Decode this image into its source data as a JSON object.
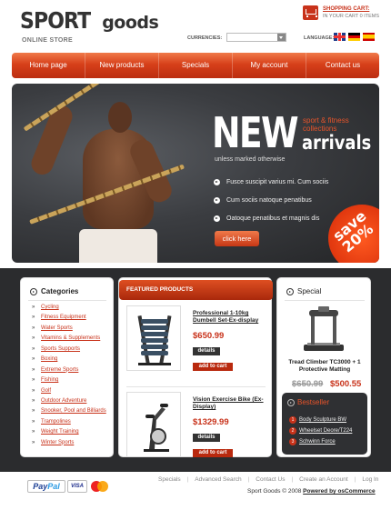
{
  "header": {
    "logo_main": "SPORT",
    "logo_secondary": "goods",
    "logo_subtitle": "ONLINE STORE",
    "cart_title": "SHOPPING CART:",
    "cart_subtitle": "IN YOUR CART 0 ITEMS",
    "currencies_label": "CURRENCIES:",
    "currency_value": "",
    "language_label": "LANGUAGE:",
    "languages": [
      "English",
      "Deutsch",
      "Español"
    ]
  },
  "nav": {
    "items": [
      "Home page",
      "New products",
      "Specials",
      "My account",
      "Contact us"
    ]
  },
  "banner": {
    "headline": "NEW",
    "collection_text": "sport & fitness collections",
    "arrivals": "arrivals",
    "note": "unless marked otherwise",
    "bullets": [
      "Fusce suscipit varius mi. Cum sociis",
      "Cum sociis natoque penatibus",
      "Oatoque penatibus et magnis dis"
    ],
    "button_label": "click here",
    "badge_text": "save 20%"
  },
  "categories": {
    "title": "Categories",
    "items": [
      "Cycling",
      "Fitness Equipment",
      "Water Sports",
      "Vitamins & Supplements",
      "Sports Supports",
      "Boxing",
      "Extreme Sports",
      "Fishing",
      "Golf",
      "Outdoor Adventure",
      "Snooker, Pool and Billiards",
      "Trampolines",
      "Weight Training",
      "Winter Sports"
    ]
  },
  "featured": {
    "title": "FEATURED PRODUCTS",
    "details_label": "details",
    "add_label": "add to cart",
    "products": [
      {
        "name": "Professional 1-10kg Dumbell Set-Ex-display",
        "price": "$650.99"
      },
      {
        "name": "Vision Exercise Bike (Ex-Display)",
        "price": "$1329.99"
      }
    ]
  },
  "special": {
    "title": "Special",
    "product_name": "Tread Climber TC3000 + 1 Protective Matting",
    "old_price": "$650.99",
    "new_price": "$500.55",
    "bestseller_title": "Bestseller",
    "bestsellers": [
      {
        "num": "1",
        "name": "Body Sculpture BW"
      },
      {
        "num": "2",
        "name": "Wheelset Deore/T224"
      },
      {
        "num": "3",
        "name": "Schwinn Force"
      }
    ]
  },
  "footer": {
    "links": [
      "Specials",
      "Advanced Search",
      "Contact Us",
      "Create an Account",
      "Log In"
    ],
    "copyright": "Sport Goods © 2008",
    "powered": "Powered by osCommerce",
    "payment": [
      "PayPal",
      "VISA",
      "MasterCard"
    ]
  },
  "colors": {
    "accent": "#c8321a",
    "nav_gradient_top": "#f07a4a",
    "dark_bg": "#2b2c2e"
  }
}
